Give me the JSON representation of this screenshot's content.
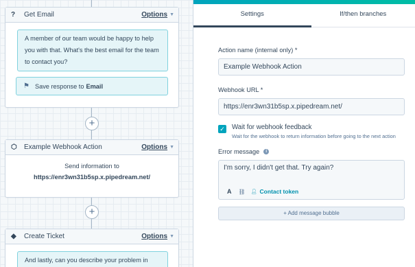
{
  "canvas": {
    "cards": [
      {
        "icon": "?",
        "title": "Get Email",
        "options": "Options",
        "message": "A member of our team would be happy to help you with that. What's the best email for the team to contact you?",
        "save_prefix": "Save response to",
        "save_target": "Email"
      },
      {
        "icon": "webhook-cube-icon",
        "title": "Example Webhook Action",
        "options": "Options",
        "line1": "Send information to",
        "line2": "https://enr3wn31b5sp.x.pipedream.net/"
      },
      {
        "icon": "ticket-icon",
        "title": "Create Ticket",
        "options": "Options",
        "message": "And lastly, can you describe your problem in"
      }
    ],
    "add_symbol": "+"
  },
  "panel": {
    "tabs": [
      "Settings",
      "If/then branches"
    ],
    "active_tab": "Settings",
    "action_name_label": "Action name (internal only) *",
    "action_name_value": "Example Webhook Action",
    "webhook_url_label": "Webhook URL *",
    "webhook_url_value": "https://enr3wn31b5sp.x.pipedream.net/",
    "wait_label": "Wait for webhook feedback",
    "wait_help": "Wait for the webhook to return information before going to the next action",
    "wait_checked": true,
    "error_label": "Error message",
    "error_value": "I'm sorry, I didn't get that. Try again?",
    "font_button": "A",
    "contact_token": "Contact token",
    "add_bubble": "+ Add message bubble"
  },
  "colors": {
    "accent": "#00a4bd",
    "bubble": "#e5f5f8",
    "text": "#33475b"
  }
}
